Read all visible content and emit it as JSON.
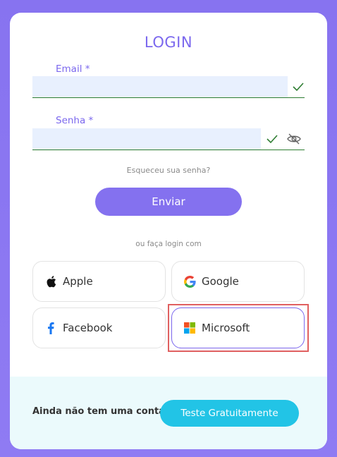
{
  "login": {
    "title": "LOGIN",
    "email": {
      "label": "Email *",
      "value": ""
    },
    "password": {
      "label": "Senha *",
      "value": ""
    },
    "forgot_link": "Esqueceu sua senha?",
    "submit_label": "Enviar",
    "or_login_with": "ou faça login com"
  },
  "social": {
    "apple": "Apple",
    "google": "Google",
    "facebook": "Facebook",
    "microsoft": "Microsoft"
  },
  "footer": {
    "no_account": "Ainda não tem uma conta?",
    "trial_button": "Teste Gratuitamente"
  },
  "colors": {
    "accent": "#7b68ee",
    "valid": "#2e7d32",
    "trial": "#22c4e6"
  }
}
